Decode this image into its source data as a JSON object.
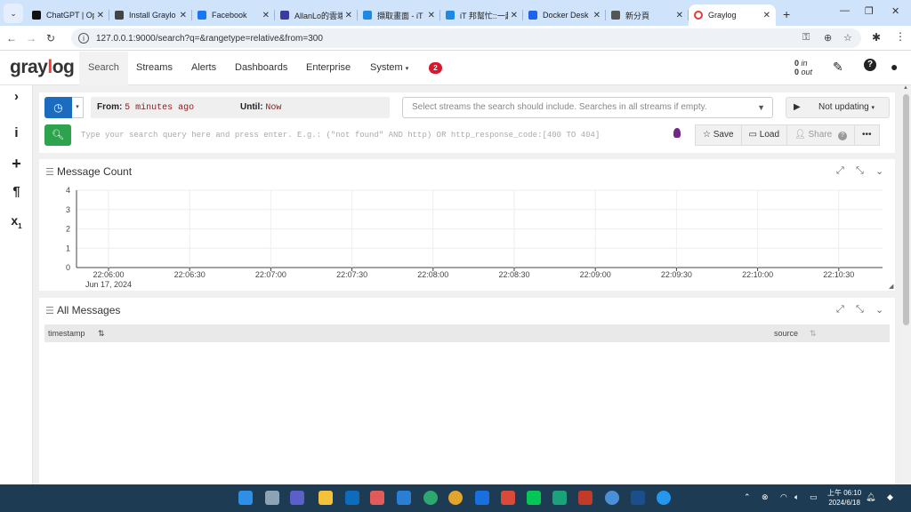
{
  "browser": {
    "tabs": [
      {
        "title": "ChatGPT | Op",
        "color": "#111111"
      },
      {
        "title": "Install Graylo",
        "color": "#444444"
      },
      {
        "title": "Facebook",
        "color": "#1877f2"
      },
      {
        "title": "AllanLo的雲端",
        "color": "#3b3aa0"
      },
      {
        "title": "擷取畫面 - iT",
        "color": "#1e88e5"
      },
      {
        "title": "iT 邦幫忙::一起",
        "color": "#1e88e5"
      },
      {
        "title": "Docker Desk",
        "color": "#1d63ed"
      },
      {
        "title": "新分頁",
        "color": "#555555"
      },
      {
        "title": "Graylog",
        "color": "#e53935"
      }
    ],
    "active_tab": "Graylog",
    "url": "127.0.0.1:9000/search?q=&rangetype=relative&from=300"
  },
  "nav": {
    "logo": "graylog",
    "links": [
      "Search",
      "Streams",
      "Alerts",
      "Dashboards",
      "Enterprise",
      "System"
    ],
    "notifications": "2",
    "throughput_in": "0",
    "throughput_in_label": "in",
    "throughput_out": "0",
    "throughput_out_label": "out"
  },
  "search": {
    "from_label": "From:",
    "from_value": "5 minutes ago",
    "until_label": "Until:",
    "until_value": "Now",
    "streams_placeholder": "Select streams the search should include. Searches in all streams if empty.",
    "update_label": "Not updating",
    "query_placeholder": "Type your search query here and press enter. E.g.: (\"not found\" AND http) OR http_response_code:[400 TO 404]",
    "save_label": "Save",
    "load_label": "Load",
    "share_label": "Share"
  },
  "message_count": {
    "title": "Message Count"
  },
  "chart_data": {
    "type": "bar",
    "title": "Message Count",
    "y_ticks": [
      "0",
      "1",
      "2",
      "3",
      "4"
    ],
    "ylim": [
      0,
      4
    ],
    "x_ticks": [
      "22:06:00",
      "22:06:30",
      "22:07:00",
      "22:07:30",
      "22:08:00",
      "22:08:30",
      "22:09:00",
      "22:09:30",
      "22:10:00",
      "22:10:30"
    ],
    "x_date": "Jun 17, 2024",
    "values": [],
    "grid": true
  },
  "all_messages": {
    "title": "All Messages",
    "columns": [
      "timestamp",
      "source"
    ]
  },
  "taskbar": {
    "clock_time": "上午 06:10",
    "clock_date": "2024/6/18"
  }
}
